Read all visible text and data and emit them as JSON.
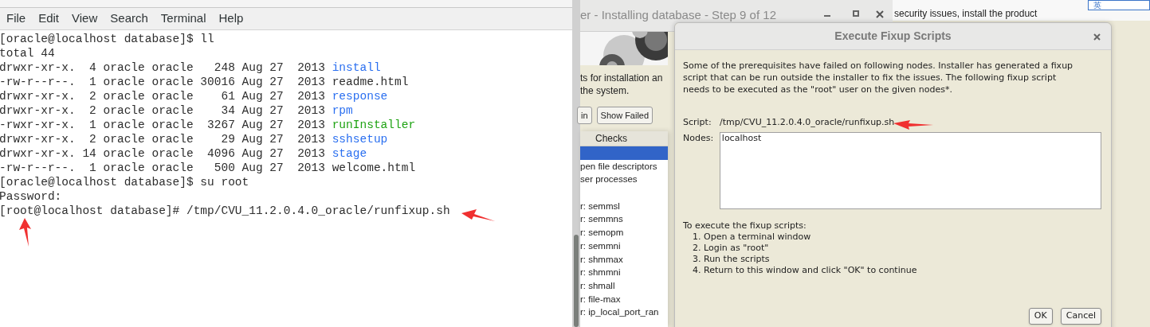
{
  "terminal": {
    "menu": [
      "File",
      "Edit",
      "View",
      "Search",
      "Terminal",
      "Help"
    ],
    "lines": [
      {
        "text": "[oracle@localhost database]$ ll"
      },
      {
        "text": "total 44"
      },
      {
        "text": "drwxr-xr-x.  4 oracle oracle   248 Aug 27  2013 ",
        "file": "install",
        "kind": "dir"
      },
      {
        "text": "-rw-r--r--.  1 oracle oracle 30016 Aug 27  2013 ",
        "file": "readme.html",
        "kind": "plain"
      },
      {
        "text": "drwxr-xr-x.  2 oracle oracle    61 Aug 27  2013 ",
        "file": "response",
        "kind": "dir"
      },
      {
        "text": "drwxr-xr-x.  2 oracle oracle    34 Aug 27  2013 ",
        "file": "rpm",
        "kind": "dir"
      },
      {
        "text": "-rwxr-xr-x.  1 oracle oracle  3267 Aug 27  2013 ",
        "file": "runInstaller",
        "kind": "exec"
      },
      {
        "text": "drwxr-xr-x.  2 oracle oracle    29 Aug 27  2013 ",
        "file": "sshsetup",
        "kind": "dir"
      },
      {
        "text": "drwxr-xr-x. 14 oracle oracle  4096 Aug 27  2013 ",
        "file": "stage",
        "kind": "dir"
      },
      {
        "text": "-rw-r--r--.  1 oracle oracle   500 Aug 27  2013 ",
        "file": "welcome.html",
        "kind": "plain"
      },
      {
        "text": "[oracle@localhost database]$ su root"
      },
      {
        "text": "Password:"
      },
      {
        "text": "[root@localhost database]# /tmp/CVU_11.2.0.4.0_oracle/runfixup.sh"
      }
    ]
  },
  "installer": {
    "title": "er - Installing database - Step 9 of 12",
    "banner_text": "security issues, install the product",
    "input_indicator": "英",
    "intro": [
      "ts for installation an",
      "the system."
    ],
    "buttons": [
      "in",
      "Show Failed"
    ],
    "column": "Checks",
    "checks": [
      {
        "selected": true
      },
      {
        "label": "pen file descriptors",
        "selected": false
      },
      {
        "label": "ser processes",
        "selected": false
      }
    ],
    "kernel_checks": [
      {
        "label": "r: semmsl",
        "selected": false
      },
      {
        "label": "r: semmns",
        "selected": false
      },
      {
        "label": "r: semopm",
        "selected": false
      },
      {
        "label": "r: semmni",
        "selected": false
      },
      {
        "label": "r: shmmax",
        "selected": false
      },
      {
        "label": "r: shmmni",
        "selected": false
      },
      {
        "label": "r: shmall",
        "selected": false
      },
      {
        "label": "r: file-max",
        "selected": false
      },
      {
        "label": "r: ip_local_port_ran",
        "selected": false
      }
    ]
  },
  "dialog": {
    "title": "Execute Fixup Scripts",
    "message": "Some of the prerequisites have failed on following nodes. Installer has generated a fixup script that can be run outside the installer to fix the issues. The following fixup script needs to be executed as the \"root\" user on the given nodes*.",
    "script_label": "Script:",
    "script": "/tmp/CVU_11.2.0.4.0_oracle/runfixup.sh",
    "nodes_label": "Nodes:",
    "nodes": "localhost",
    "instructions_title": "To execute the fixup scripts:",
    "steps": [
      "1. Open a terminal window",
      "2. Login as \"root\"",
      "3. Run the scripts",
      "4. Return to this window and click \"OK\" to continue"
    ],
    "buttons": [
      "OK",
      "Cancel"
    ]
  }
}
